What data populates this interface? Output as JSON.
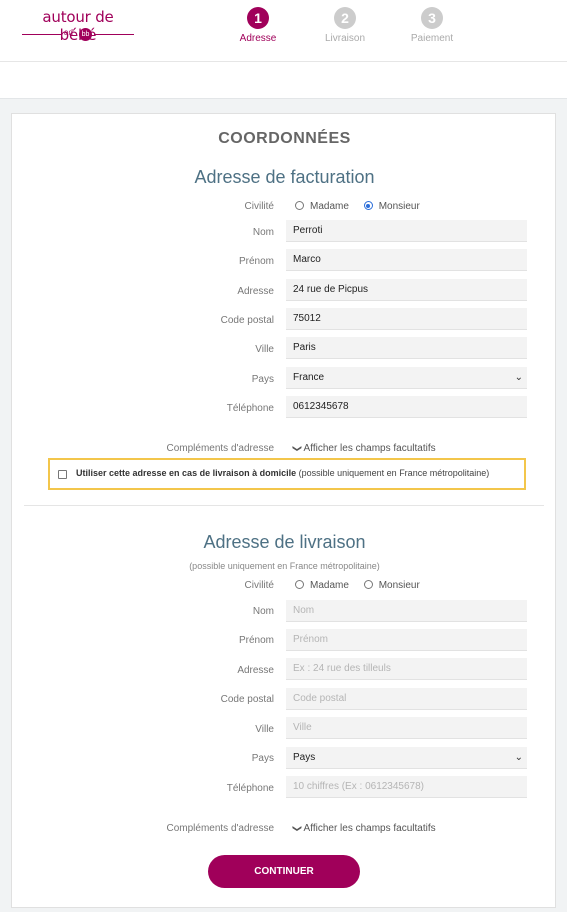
{
  "brand": {
    "name": "autour de bébé",
    "ad": "ad",
    "bb": "bb"
  },
  "steps": [
    {
      "num": "1",
      "label": "Adresse"
    },
    {
      "num": "2",
      "label": "Livraison"
    },
    {
      "num": "3",
      "label": "Paiement"
    }
  ],
  "page_title": "COORDONNÉES",
  "billing": {
    "title": "Adresse de facturation",
    "civility_label": "Civilité",
    "madame": "Madame",
    "monsieur": "Monsieur",
    "nom_label": "Nom",
    "nom_value": "Perroti",
    "prenom_label": "Prénom",
    "prenom_value": "Marco",
    "adresse_label": "Adresse",
    "adresse_value": "24 rue de Picpus",
    "cp_label": "Code postal",
    "cp_value": "75012",
    "ville_label": "Ville",
    "ville_value": "Paris",
    "pays_label": "Pays",
    "pays_value": "France",
    "tel_label": "Téléphone",
    "tel_value": "0612345678",
    "complements_label": "Compléments d'adresse",
    "complements_toggle": "Afficher les champs facultatifs",
    "use_for_delivery_bold": "Utiliser cette adresse en cas de livraison à domicile",
    "use_for_delivery_note": "(possible uniquement en France métropolitaine)"
  },
  "delivery": {
    "title": "Adresse de livraison",
    "subtitle": "(possible uniquement en France métropolitaine)",
    "civility_label": "Civilité",
    "madame": "Madame",
    "monsieur": "Monsieur",
    "nom_label": "Nom",
    "nom_placeholder": "Nom",
    "prenom_label": "Prénom",
    "prenom_placeholder": "Prénom",
    "adresse_label": "Adresse",
    "adresse_placeholder": "Ex : 24 rue des tilleuls",
    "cp_label": "Code postal",
    "cp_placeholder": "Code postal",
    "ville_label": "Ville",
    "ville_placeholder": "Ville",
    "pays_label": "Pays",
    "pays_value": "Pays",
    "tel_label": "Téléphone",
    "tel_placeholder": "10 chiffres (Ex : 0612345678)",
    "complements_label": "Compléments d'adresse",
    "complements_toggle": "Afficher les champs facultatifs"
  },
  "continue_label": "CONTINUER",
  "colors": {
    "brand": "#a0005a",
    "section_title": "#4e7184",
    "highlight": "#f3c64b",
    "radio_checked": "#2a6dd9"
  }
}
